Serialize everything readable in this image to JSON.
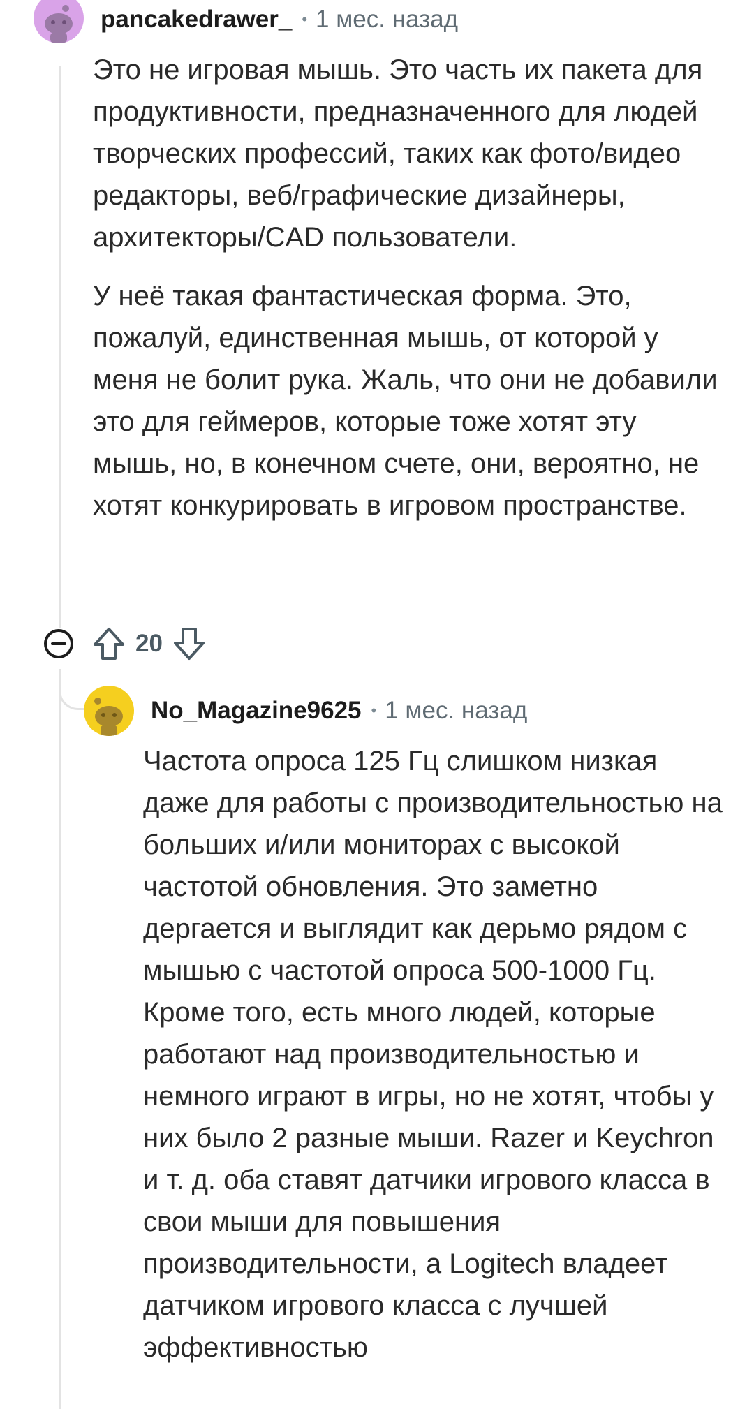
{
  "comment1": {
    "username": "pancakedrawer_",
    "separator": "•",
    "time": "1 мес. назад",
    "avatar_color": "#d9a3e8",
    "paragraphs": [
      "Это не игровая мышь. Это часть их пакета для продуктивности, предназначенного для людей творческих профессий, таких как фото/видео редакторы, веб/графические дизайнеры, архитекторы/CAD пользователи.",
      "У неё такая фантастическая форма. Это, пожалуй, единственная мышь, от которой у меня не болит рука. Жаль, что они не добавили это для геймеров, которые тоже хотят эту мышь, но, в конечном счете, они, вероятно, не хотят конкурировать в игровом пространстве."
    ],
    "votes": "20",
    "collapse_icon": "collapse-minus-icon",
    "upvote_icon": "upvote-arrow-icon",
    "downvote_icon": "downvote-arrow-icon"
  },
  "comment2": {
    "username": "No_Magazine9625",
    "separator": "•",
    "time": "1 мес. назад",
    "avatar_color": "#f5cf1f",
    "paragraphs": [
      "Частота опроса 125 Гц слишком низкая даже для работы с производительностью на больших и/или мониторах с высокой частотой обновления. Это заметно дергается и выглядит как дерьмо рядом с мышью с частотой опроса 500-1000 Гц. Кроме того, есть много людей, которые работают над производительностью и немного играют в игры, но не хотят, чтобы у них было 2 разные мыши. Razer и Keychron и т. д. оба ставят датчики игрового класса в свои мыши для повышения производительности, а Logitech владеет датчиком игрового класса с лучшей эффективностью"
    ]
  },
  "colors": {
    "thread_line": "#e3e3e3",
    "meta_text": "#5f6b73",
    "vote_text": "#4b5a63"
  }
}
